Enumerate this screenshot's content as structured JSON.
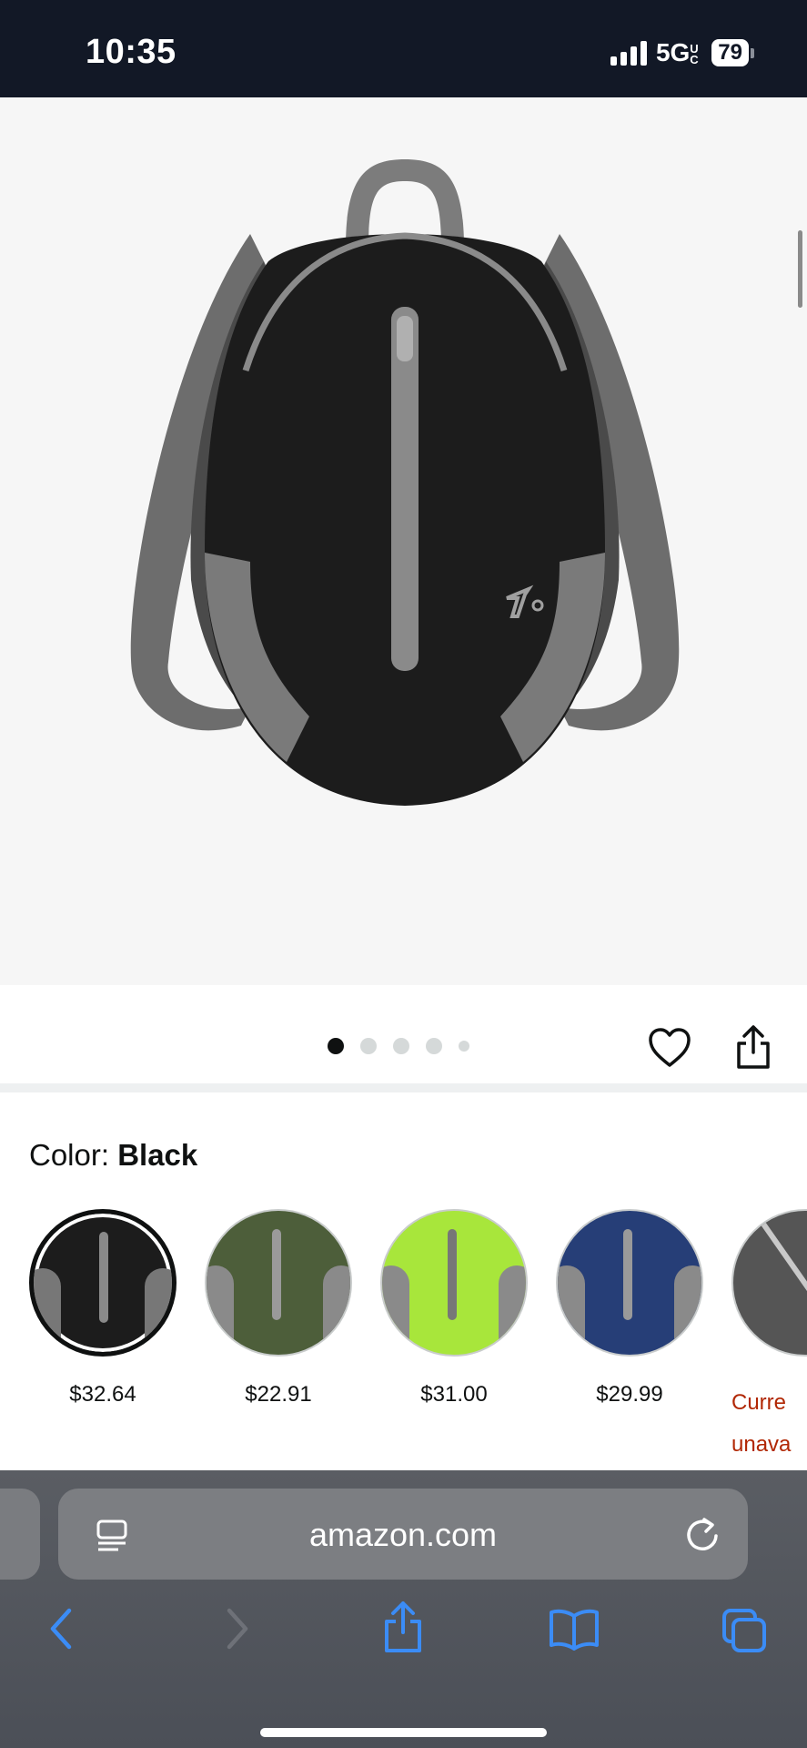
{
  "status": {
    "time": "10:35",
    "network": "5G",
    "network_sub": "UC",
    "battery": "79"
  },
  "gallery": {
    "dot_count": 5,
    "active_index": 0
  },
  "color": {
    "label": "Color:",
    "selected": "Black",
    "swatches": [
      {
        "name": "Black",
        "price": "$32.64",
        "color": "#1c1c1c"
      },
      {
        "name": "Green",
        "price": "$22.91",
        "color": "#4d5e3a"
      },
      {
        "name": "Lime",
        "price": "$31.00",
        "color": "#a8e63b"
      },
      {
        "name": "Navy",
        "price": "$29.99",
        "color": "#263e77"
      },
      {
        "name": "Gray",
        "unavailable_line1": "Curre",
        "unavailable_line2": "unava",
        "color": "#555555"
      }
    ]
  },
  "browser": {
    "url": "amazon.com"
  },
  "colors": {
    "status_bar": "#121826",
    "accent_blue": "#3b8cf6",
    "unavailable_red": "#b12704"
  }
}
